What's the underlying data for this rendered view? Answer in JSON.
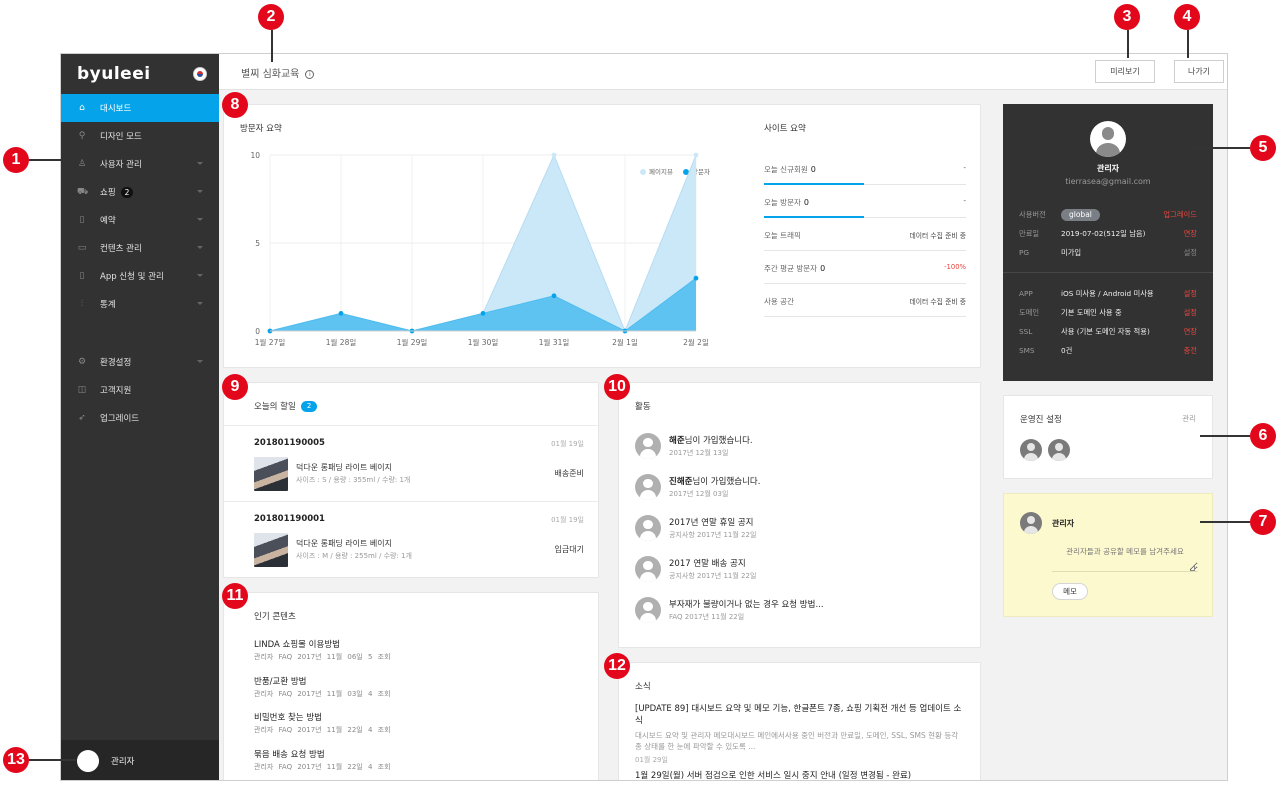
{
  "sidebar": {
    "logo": "byuleei",
    "items": [
      {
        "label": "대시보드",
        "icon": "home-icon",
        "glyph": "⌂"
      },
      {
        "label": "디자인 모드",
        "icon": "brush-icon",
        "glyph": "⚲"
      },
      {
        "label": "사용자 관리",
        "icon": "user-icon",
        "glyph": "♙"
      },
      {
        "label": "쇼핑",
        "icon": "cart-icon",
        "glyph": "⛟",
        "badge": "2"
      },
      {
        "label": "예약",
        "icon": "clipboard-icon",
        "glyph": "▯"
      },
      {
        "label": "컨텐츠 관리",
        "icon": "inbox-icon",
        "glyph": "▭"
      },
      {
        "label": "App 신청 및 관리",
        "icon": "phone-icon",
        "glyph": "▯"
      },
      {
        "label": "통계",
        "icon": "bar-chart-icon",
        "glyph": "⫶"
      },
      {
        "label": "환경설정",
        "icon": "gear-icon",
        "glyph": "⚙"
      },
      {
        "label": "고객지원",
        "icon": "support-icon",
        "glyph": "◫"
      },
      {
        "label": "업그레이드",
        "icon": "rocket-icon",
        "glyph": "➶"
      }
    ],
    "user": "관리자"
  },
  "header": {
    "title": "별찌 심화교육",
    "info_icon": "i",
    "preview": "미리보기",
    "exit": "나가기"
  },
  "markers": [
    "1",
    "2",
    "3",
    "4",
    "5",
    "6",
    "7",
    "8",
    "9",
    "10",
    "11",
    "12",
    "13"
  ],
  "visitor": {
    "title": "방문자 요약",
    "legend": [
      "페이지뷰",
      "방문자"
    ]
  },
  "chart_data": {
    "type": "area",
    "title": "방문자 요약",
    "categories": [
      "1월 27일",
      "1월 28일",
      "1월 29일",
      "1월 30일",
      "1월 31일",
      "2월 1일",
      "2월 2일"
    ],
    "series": [
      {
        "name": "페이지뷰",
        "values": [
          0,
          1,
          0,
          1,
          10,
          0,
          10
        ],
        "color": "#cbe8f8"
      },
      {
        "name": "방문자",
        "values": [
          0,
          1,
          0,
          1,
          2,
          0,
          3
        ],
        "color": "#05a4ea"
      }
    ],
    "yticks": [
      "0",
      "5",
      "10"
    ],
    "ylim": [
      0,
      10
    ],
    "grid": true,
    "legend_position": "top-right"
  },
  "site": {
    "title": "사이트 요약",
    "rows": [
      {
        "label": "오늘 신규회원",
        "num": "0",
        "value": "-",
        "bar": true
      },
      {
        "label": "오늘 방문자",
        "num": "0",
        "value": "-",
        "bar": true
      },
      {
        "label": "오늘 트래픽",
        "num": "",
        "value": "데이터 수집 준비 중",
        "bar": false
      },
      {
        "label": "주간 평균 방문자",
        "num": "0",
        "value": "-100%",
        "bar": false,
        "red": true
      },
      {
        "label": "사용 공간",
        "num": "",
        "value": "데이터 수집 준비 중",
        "bar": false
      }
    ]
  },
  "todo": {
    "title": "오늘의 할일",
    "count": "2",
    "orders": [
      {
        "id": "201801190005",
        "date": "01월 19일",
        "name": "덕다운 롱패딩 라이트 베이지",
        "opt": "사이즈 : S / 용량 : 355ml / 수량: 1개",
        "status": "배송준비"
      },
      {
        "id": "201801190001",
        "date": "01월 19일",
        "name": "덕다운 롱패딩 라이트 베이지",
        "opt": "사이즈 : M / 용량 : 255ml / 수량: 1개",
        "status": "입금대기"
      }
    ]
  },
  "popular": {
    "title": "인기 콘텐츠",
    "items": [
      {
        "title": "LINDA 쇼핑몰 이용방법",
        "meta": "관리자 FAQ 2017년 11월 06일 5 조회"
      },
      {
        "title": "반품/교환 방법",
        "meta": "관리자 FAQ 2017년 11월 03일 4 조회"
      },
      {
        "title": "비밀번호 찾는 방법",
        "meta": "관리자 FAQ 2017년 11월 22일 4 조회"
      },
      {
        "title": "묶음 배송 요청 방법",
        "meta": "관리자 FAQ 2017년 11월 22일 4 조회"
      }
    ]
  },
  "activity": {
    "title": "활동",
    "items": [
      {
        "bold": "해준",
        "text": "님이 가입했습니다.",
        "meta": "2017년 12월 13일"
      },
      {
        "bold": "진해준",
        "text": "님이 가입했습니다.",
        "meta": "2017년 12월 03일"
      },
      {
        "bold": "",
        "text": "2017년 연말 휴일 공지",
        "meta": "공지사항 2017년 11월 22일"
      },
      {
        "bold": "",
        "text": "2017 연말 배송 공지",
        "meta": "공지사항 2017년 11월 22일"
      },
      {
        "bold": "",
        "text": "부자재가 불량이거나 없는 경우 요청 방법...",
        "meta": "FAQ 2017년 11월 22일"
      }
    ]
  },
  "news": {
    "title": "소식",
    "headline": "[UPDATE 89] 대시보드 요약 및 메모 기능, 한글폰트 7종, 쇼핑 기획전 개선 등 업데이트 소식",
    "summary": "대시보드 요약 및 관리자 메모대시보드 메인에서사용 중인 버전과 만료일, 도메인, SSL, SMS 현황 등각종 상태를 한 눈에 파악할 수 있도록 ...",
    "date": "01월 29일",
    "next": "1월 29일(월) 서버 점검으로 인한 서비스 일시 중지 안내 (일정 변경됨 - 완료)"
  },
  "profile": {
    "name": "관리자",
    "email": "tierrasea@gmail.com",
    "rows": [
      {
        "k": "사용버전",
        "v": "global",
        "a": "업그레이드",
        "pill": true
      },
      {
        "k": "만료일",
        "v": "2019-07-02(512일 남음)",
        "a": "연장"
      },
      {
        "k": "PG",
        "v": "미가입",
        "a": "설정",
        "muted": true
      },
      {
        "k": "APP",
        "v": "iOS 미사용 / Android 미사용",
        "a": "설정"
      },
      {
        "k": "도메인",
        "v": "기본 도메인 사용 중",
        "a": "설정"
      },
      {
        "k": "SSL",
        "v": "사용 (기본 도메인 자동 적용)",
        "a": "연장"
      },
      {
        "k": "SMS",
        "v": "0건",
        "a": "충전"
      }
    ]
  },
  "ops": {
    "title": "운영진 설정",
    "manage": "관리"
  },
  "memo": {
    "name": "관리자",
    "placeholder": "관리자들과 공유할 메모를 남겨주세요",
    "button": "메모"
  },
  "colors": {
    "accent": "#05a4ea",
    "sidebar": "#323232",
    "marker": "#e3071b",
    "warn": "#e8473f"
  }
}
